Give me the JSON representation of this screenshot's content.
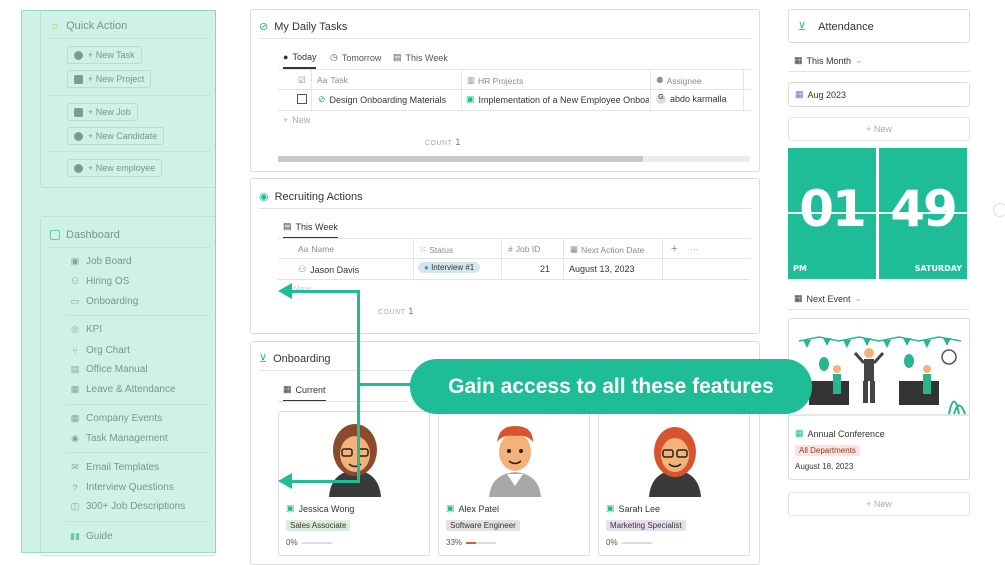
{
  "quick_action": {
    "title": "Quick Action",
    "buttons": [
      "+ New Task",
      "+ New Project",
      "+ New Job",
      "+ New Candidate",
      "+ New employee"
    ]
  },
  "dashboard": {
    "title": "Dashboard",
    "items": [
      "Job Board",
      "Hiring OS",
      "Onboarding",
      "KPI",
      "Org Chart",
      "Office Manual",
      "Leave & Attendance",
      "Company Events",
      "Task Management",
      "Email Templates",
      "Interview Questions",
      "300+ Job Descriptions",
      "Guide"
    ]
  },
  "daily_tasks": {
    "title": "My Daily Tasks",
    "tabs": [
      "Today",
      "Tomorrow",
      "This Week"
    ],
    "columns": [
      "Task",
      "HR Projects",
      "Assignee"
    ],
    "rows": [
      {
        "task": "Design Onboarding Materials",
        "project": "Implementation of a New Employee Onboa",
        "assignee": "abdo karmalla"
      }
    ],
    "new_label": "New",
    "count_label": "COUNT",
    "count": "1"
  },
  "recruiting": {
    "title": "Recruiting Actions",
    "tab": "This Week",
    "columns": [
      "Name",
      "Status",
      "Job ID",
      "Next Action Date"
    ],
    "rows": [
      {
        "name": "Jason Davis",
        "status": "Interview #1",
        "job_id": "21",
        "date": "August 13, 2023"
      }
    ],
    "add": "+",
    "more": "···",
    "new_label": "New",
    "count_label": "COUNT",
    "count": "1"
  },
  "onboarding": {
    "title": "Onboarding",
    "tab": "Current",
    "cards": [
      {
        "name": "Jessica Wong",
        "role": "Sales Associate",
        "progress": "0%",
        "progress_value": 0,
        "role_color": "#dbeddb"
      },
      {
        "name": "Alex Patel",
        "role": "Software Engineer",
        "progress": "33%",
        "progress_value": 33,
        "role_color": "#e3e2e0"
      },
      {
        "name": "Sarah Lee",
        "role": "Marketing Specialist",
        "progress": "0%",
        "progress_value": 0,
        "role_color": "#e8deee"
      }
    ]
  },
  "attendance": {
    "title": "Attendance",
    "view": "This Month",
    "month": "Aug 2023",
    "new_label": "+ New"
  },
  "clock": {
    "hour": "01",
    "minute": "49",
    "ampm": "PM",
    "day": "SATURDAY"
  },
  "next_event": {
    "title": "Next Event",
    "event_name": "Annual Conference",
    "tag": "All Departments",
    "date": "August 18, 2023",
    "new_label": "+ New"
  },
  "callout": "Gain access to all these features",
  "colors": {
    "accent": "#1fbc98",
    "overlay": "#a8e8d4"
  }
}
